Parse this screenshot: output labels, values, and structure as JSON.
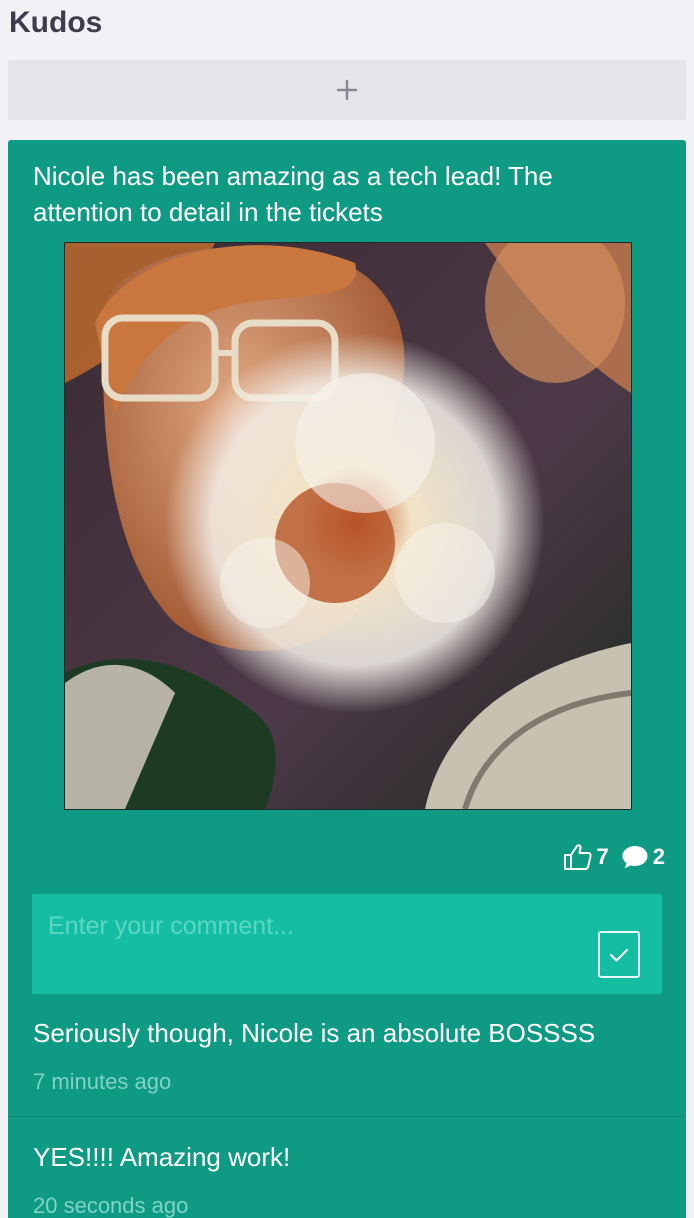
{
  "header": {
    "title": "Kudos"
  },
  "add_button": {
    "icon": "plus-icon"
  },
  "kudo": {
    "message": "Nicole has been amazing as a tech lead! The attention to detail in the tickets",
    "likes": "7",
    "comments_count": "2",
    "like_icon": "thumbs-up-icon",
    "comment_icon": "speech-bubble-icon",
    "comment_input": {
      "value": "",
      "placeholder": "Enter your comment..."
    },
    "submit_icon": "checkmark-icon",
    "comments": [
      {
        "text": "Seriously though, Nicole is an absolute BOSSSS",
        "time": "7 minutes ago"
      },
      {
        "text": "YES!!!! Amazing work!",
        "time": "20 seconds ago"
      }
    ]
  },
  "colors": {
    "page_bg": "#f2f2f6",
    "card_bg": "#0f9a84",
    "input_bg": "#15bea3",
    "title": "#3f3c4c"
  }
}
